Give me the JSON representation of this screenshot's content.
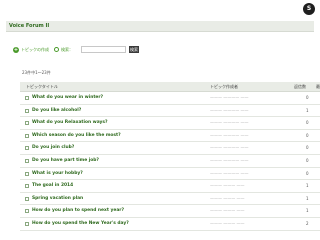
{
  "app": {
    "logo_text": "S"
  },
  "forum": {
    "title": "Voice Forum II"
  },
  "toolbar": {
    "create_label": "トピックの作成",
    "search_label": "検索：",
    "search_value": "",
    "search_button_label": "検索"
  },
  "topics": {
    "count_text": "23件中1～23件",
    "columns": {
      "title": "トピックタイトル",
      "creator": "トピック作成者",
      "replies": "返信数",
      "extra": "最"
    },
    "rows": [
      {
        "title": "What do you wear in winter?",
        "creator": "——— ———— ——",
        "replies": "0"
      },
      {
        "title": "Do you like alcohol?",
        "creator": "——— ———— ——",
        "replies": "1"
      },
      {
        "title": "What do you Relaxation ways?",
        "creator": "——— ———— ——",
        "replies": "0"
      },
      {
        "title": "Which season do you like the most?",
        "creator": "——— ———— ——",
        "replies": "0"
      },
      {
        "title": "Do you join club?",
        "creator": "——— ———— ——",
        "replies": "0"
      },
      {
        "title": "Do you have part time job?",
        "creator": "——— ———— ——",
        "replies": "0"
      },
      {
        "title": "What is your hobby?",
        "creator": "——— ———— ——",
        "replies": "0"
      },
      {
        "title": "The goal in 2014",
        "creator": "——— ——— ——",
        "replies": "1"
      },
      {
        "title": "Spring vacation plan",
        "creator": "——— ——— ——",
        "replies": "1"
      },
      {
        "title": "How do you plan to spend next year?",
        "creator": "——— ——— ——",
        "replies": "1"
      },
      {
        "title": "How do you spend the New Year's day?",
        "creator": "——— ——— ——",
        "replies": "2"
      }
    ]
  }
}
